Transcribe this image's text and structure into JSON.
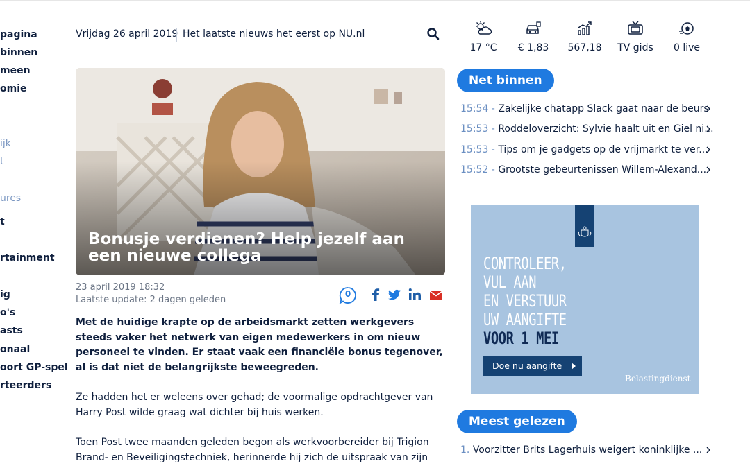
{
  "nav": {
    "items": [
      {
        "label": "pagina",
        "style": "bold"
      },
      {
        "label": "binnen",
        "style": "bold"
      },
      {
        "label": "meen",
        "style": "bold"
      },
      {
        "label": "omie",
        "style": "bold"
      },
      {
        "label": "ijk",
        "style": "light"
      },
      {
        "label": "t",
        "style": "light"
      },
      {
        "label": "ures",
        "style": "light"
      },
      {
        "label": "t",
        "style": "bold"
      },
      {
        "label": "rtainment",
        "style": "bold"
      },
      {
        "label": "ig",
        "style": "bold"
      },
      {
        "label": "o's",
        "style": "bold"
      },
      {
        "label": "asts",
        "style": "bold"
      },
      {
        "label": "onaal",
        "style": "bold"
      },
      {
        "label": "oort GP-spel",
        "style": "bold"
      },
      {
        "label": "rteerders",
        "style": "bold"
      }
    ]
  },
  "header": {
    "date": "Vrijdag 26 april 2019",
    "tagline": "Het laatste nieuws het eerst op NU.nl",
    "search_icon": "search-icon"
  },
  "widgets": [
    {
      "icon": "weather-icon",
      "label": "17 °C"
    },
    {
      "icon": "fuel-car-icon",
      "label": "€ 1,83"
    },
    {
      "icon": "stock-chart-icon",
      "label": "567,18"
    },
    {
      "icon": "tv-icon",
      "label": "TV gids"
    },
    {
      "icon": "soccer-live-icon",
      "label": "0 live"
    }
  ],
  "article": {
    "title": "Bonusje verdienen? Help jezelf aan een nieuwe collega",
    "published": "23 april 2019 18:32",
    "updated": "Laatste update: 2 dagen geleden",
    "comments": "0",
    "lead": "Met de huidige krapte op de arbeidsmarkt zetten werkgevers steeds vaker het netwerk van eigen medewerkers in om nieuw personeel te vinden. Er staat vaak een financiële bonus tegenover, al is dat niet de belangrijkste beweegreden.",
    "paragraphs": [
      "Ze hadden het er weleens over gehad; de voormalige opdrachtgever van Harry Post wilde graag wat dichter bij huis werken.",
      "Toen Post twee maanden geleden begon als werkvoorbereider bij Trigion Brand- en Beveiligingstechniek, herinnerde hij zich de uitspraak van zijn"
    ]
  },
  "sidebar": {
    "net_binnen": {
      "title": "Net binnen",
      "items": [
        {
          "time": "15:54",
          "text": "Zakelijke chatapp Slack gaat naar de beurs"
        },
        {
          "time": "15:53",
          "text": "Roddeloverzicht: Sylvie haalt uit en Giel ni..."
        },
        {
          "time": "15:53",
          "text": "Tips om je gadgets op de vrijmarkt te ver..."
        },
        {
          "time": "15:52",
          "text": "Grootste gebeurtenissen Willem-Alexand..."
        }
      ]
    },
    "ad": {
      "lines": [
        "CONTROLEER,",
        "VUL AAN",
        "EN VERSTUUR",
        "UW AANGIFTE"
      ],
      "bold_line": "VOOR 1 MEI",
      "button": "Doe nu aangifte",
      "logo": "Belastingdienst"
    },
    "meest_gelezen": {
      "title": "Meest gelezen",
      "items": [
        {
          "num": "1.",
          "text": "Voorzitter Brits Lagerhuis weigert koninklijke ..."
        }
      ]
    }
  },
  "colors": {
    "accent": "#1f7ae0",
    "navy": "#0f1f3d",
    "time": "#6b8fc2",
    "ad_bg": "#a8c4e0",
    "ad_dark": "#154273",
    "mail": "#d93025"
  }
}
